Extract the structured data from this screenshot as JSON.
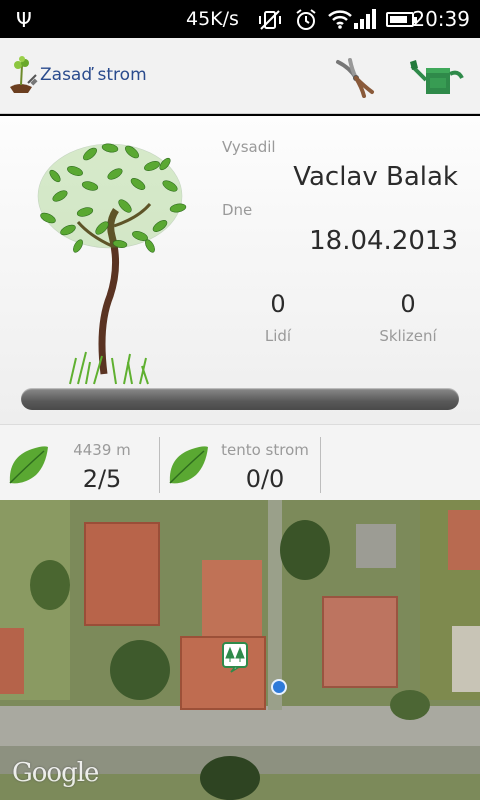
{
  "status_bar": {
    "speed": "45K/s",
    "time": "20:39",
    "usb_icon": "usb-icon",
    "mute_icon": "vibrate-off-icon",
    "alarm_icon": "alarm-icon",
    "wifi_icon": "wifi-icon",
    "signal_icon": "signal-icon",
    "battery_icon": "battery-icon",
    "battery_level": 0.85
  },
  "action_bar": {
    "title": "Zasaď strom",
    "app_icon": "tree-planting-icon",
    "pruner_icon": "pruning-shears-icon",
    "watering_icon": "watering-can-icon"
  },
  "tree_card": {
    "planted_by_label": "Vysadil",
    "planted_by": "Vaclav Balak",
    "date_label": "Dne",
    "date": "18.04.2013",
    "people_count": "0",
    "people_label": "Lidí",
    "harvest_count": "0",
    "harvest_label": "Sklizení",
    "progress": 0
  },
  "stats": {
    "distance_label": "4439 m",
    "distance_value": "2/5",
    "this_tree_label": "tento strom",
    "this_tree_value": "0/0"
  },
  "map": {
    "attribution": "Google",
    "marker_icon": "forest-marker-icon",
    "location_icon": "my-location-icon"
  },
  "colors": {
    "title": "#2a4b8d",
    "leaf_green": "#5aa832",
    "progress_track": "#595959",
    "location_blue": "#2e7ad9"
  }
}
